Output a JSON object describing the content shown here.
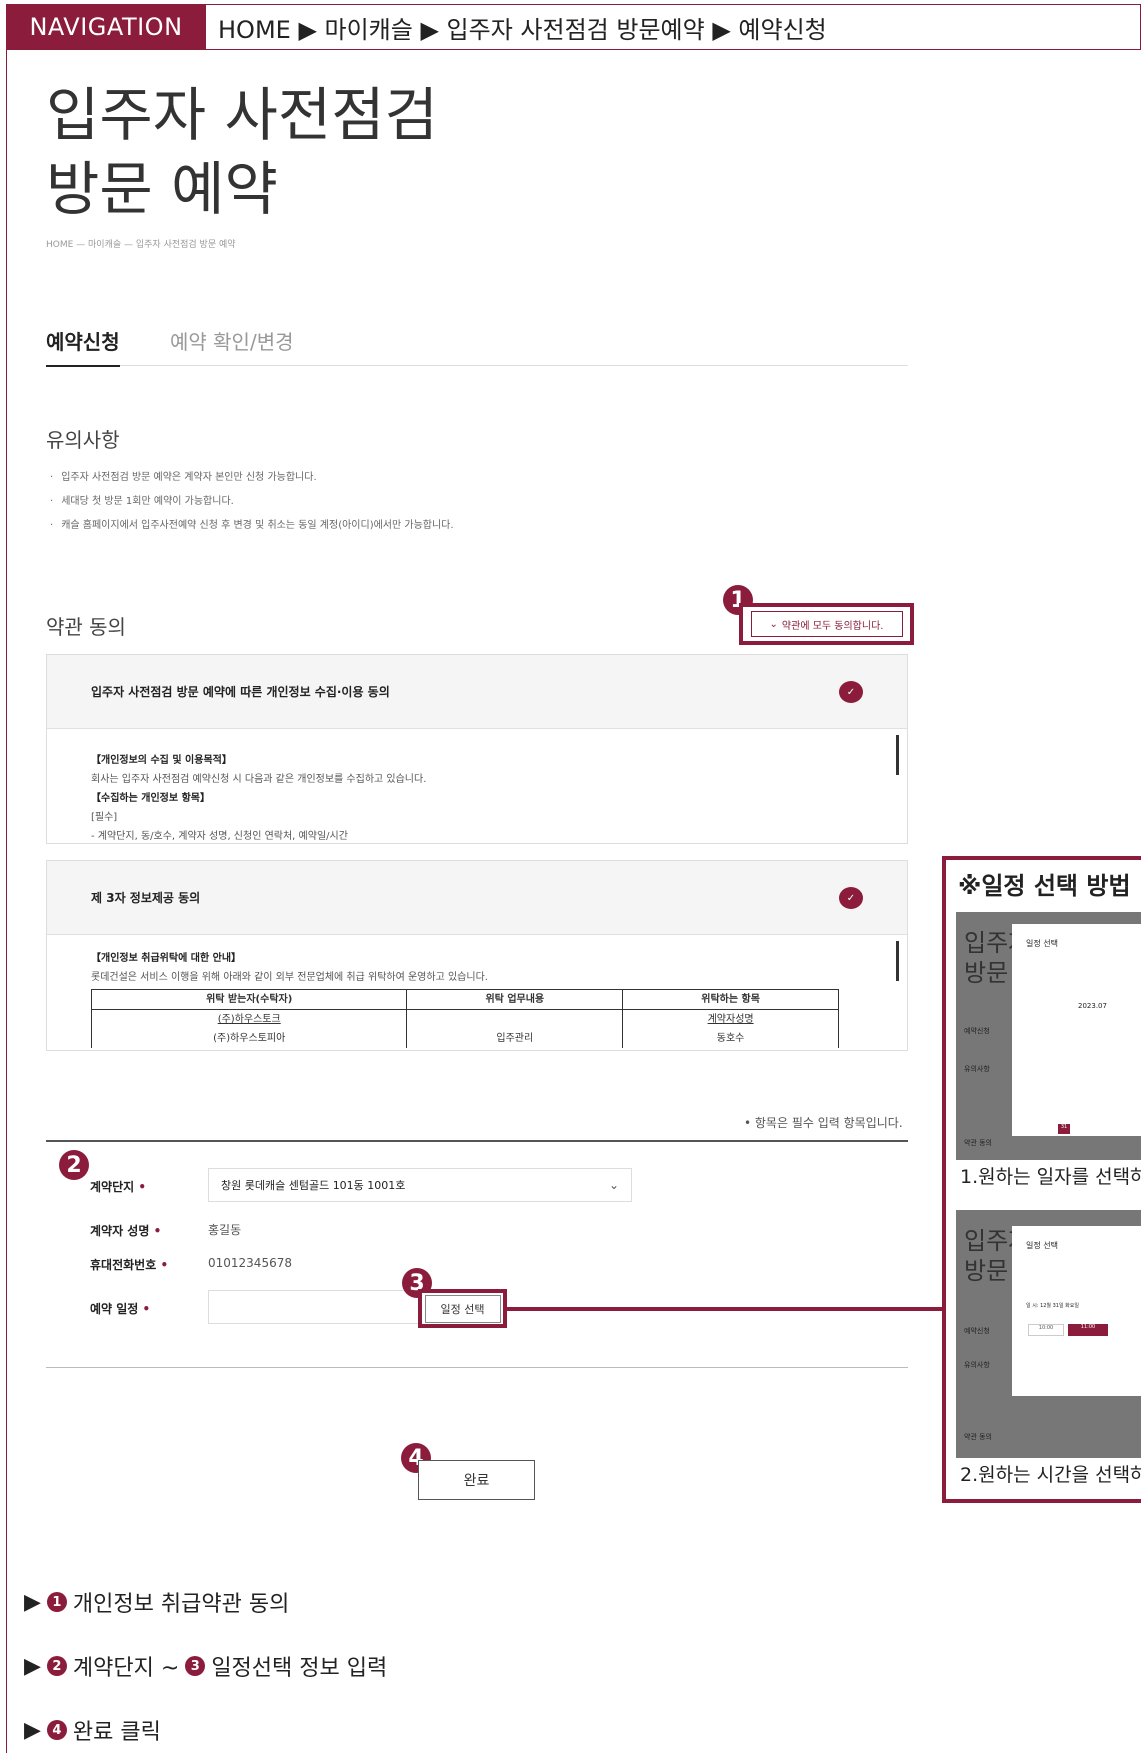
{
  "nav": {
    "label": "NAVIGATION",
    "path": "HOME ▶ 마이캐슬 ▶ 입주자 사전점검 방문예약 ▶ 예약신청"
  },
  "page": {
    "title_line1": "입주자 사전점검",
    "title_line2": "방문 예약",
    "breadcrumb": "HOME — 마이캐슬 — 입주자 사전점검 방문 예약"
  },
  "tabs": [
    {
      "label": "예약신청",
      "active": true
    },
    {
      "label": "예약 확인/변경",
      "active": false
    }
  ],
  "notice": {
    "heading": "유의사항",
    "items": [
      "입주자 사전점검 방문 예약은 계약자 본인만 신청 가능합니다.",
      "세대당 첫 방문 1회만 예약이 가능합니다.",
      "캐슬 홈페이지에서 입주사전예약 신청 후 변경 및 취소는 동일 계정(아이디)에서만 가능합니다."
    ]
  },
  "agreement": {
    "heading": "약관 동의",
    "agree_all_label": "약관에 모두 동의합니다.",
    "terms": [
      {
        "title": "입주자 사전점검 방문 예약에 따른 개인정보 수집·이용 동의",
        "lines": [
          {
            "text": "【개인정보의 수집 및 이용목적】",
            "bold": true
          },
          {
            "text": "회사는 입주자 사전점검 예약신청 시 다음과 같은 개인정보를 수집하고 있습니다.",
            "bold": false
          },
          {
            "text": "【수집하는 개인정보 항목】",
            "bold": true
          },
          {
            "text": "[필수]",
            "bold": false
          },
          {
            "text": "- 계약단지, 동/호수, 계약자 성명, 신청인 연락처, 예약일/시간",
            "bold": false
          }
        ]
      },
      {
        "title": "제 3자 정보제공 동의",
        "lines": [
          {
            "text": "【개인정보 취급위탁에 대한 안내】",
            "bold": true
          },
          {
            "text": "롯데건설은 서비스 이행을 위해 아래와 같이 외부 전문업체에 취급 위탁하여 운영하고 있습니다.",
            "bold": false
          }
        ],
        "table": {
          "headers": [
            "위탁 받는자(수탁자)",
            "위탁 업무내용",
            "위탁하는 항목"
          ],
          "rows": [
            [
              "(주)하우스토크",
              "",
              "계약자성명"
            ],
            [
              "(주)하우스토피아",
              "입주관리",
              "동호수"
            ]
          ]
        }
      }
    ]
  },
  "form": {
    "required_note": "• 항목은 필수 입력 항목입니다.",
    "fields": {
      "complex_label": "계약단지",
      "complex_value": "창원 롯데캐슬 센텀골드 101동 1001호",
      "name_label": "계약자 성명",
      "name_value": "홍길동",
      "phone_label": "휴대전화번호",
      "phone_value": "01012345678",
      "date_label": "예약 일정",
      "date_value": ""
    },
    "schedule_button": "일정 선택",
    "done_button": "완료"
  },
  "markers": [
    "1",
    "2",
    "3",
    "4"
  ],
  "guide": {
    "title": "※일정 선택 방법",
    "shot1": {
      "bg_text1": "입주자",
      "bg_text2": "방문",
      "modal_title": "일정 선택",
      "month": "2023.07",
      "selected_day": "31",
      "side_labels": [
        "예약신청",
        "유의사항",
        "약관 동의"
      ]
    },
    "shot2": {
      "bg_text1": "입주자",
      "bg_text2": "방문",
      "modal_title": "일정 선택",
      "date_line": "일 시: 12월 31일 화요일",
      "time_a": "10:00",
      "time_b": "11:00",
      "side_labels": [
        "예약신청",
        "유의사항",
        "약관 동의"
      ]
    },
    "caption1": "1.원하는 일자를 선택하",
    "caption2": "2.원하는 시간을 선택하"
  },
  "steps": [
    {
      "num": "1",
      "text": "개인정보 취급약관 동의",
      "num2": "",
      "text2": ""
    },
    {
      "num": "2",
      "text": "계약단지 ~ ",
      "num2": "3",
      "text2": "일정선택 정보 입력"
    },
    {
      "num": "4",
      "text": "완료 클릭",
      "num2": "",
      "text2": ""
    }
  ],
  "colors": {
    "accent": "#8b1c3b",
    "text": "#222222",
    "muted": "#999999"
  }
}
